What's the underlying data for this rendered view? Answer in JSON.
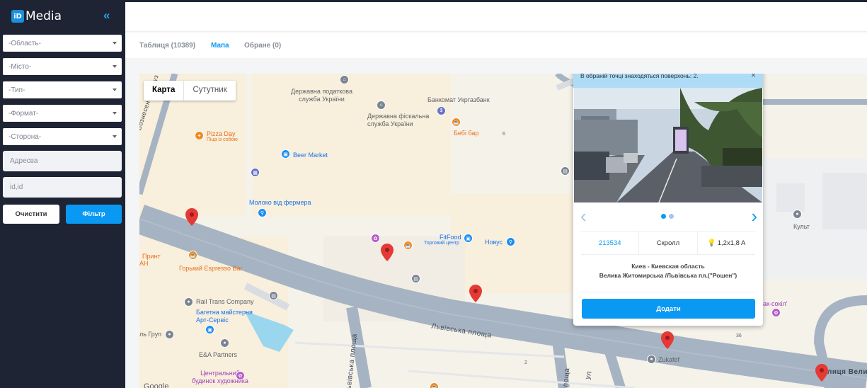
{
  "brand": {
    "logo_mark": "iD",
    "name": "Media"
  },
  "sidebar": {
    "collapse_icon": "«",
    "selects": [
      {
        "placeholder": "-Область-"
      },
      {
        "placeholder": "-Місто-"
      },
      {
        "placeholder": "-Тип-"
      },
      {
        "placeholder": "-Формат-"
      },
      {
        "placeholder": "-Сторона-"
      }
    ],
    "address_placeholder": "Адресва",
    "id_placeholder": "id,id",
    "clear_label": "Очистити",
    "filter_label": "Фільтр"
  },
  "tabs": [
    {
      "label": "Таблиця (10389)",
      "active": false
    },
    {
      "label": "Мапа",
      "active": true
    },
    {
      "label": "Обране (0)",
      "active": false
    }
  ],
  "map": {
    "type_toggle": {
      "map": "Карта",
      "satellite": "Сутутник"
    },
    "pois": {
      "tax_service": "Державна податкова\nслужба України",
      "fiscal_service": "Державна фіскальна\nслужба України",
      "atm": "Банкомат Укргазбанк",
      "bebi_bar": "Бебі бар",
      "pizza_day": "Pizza Day",
      "pizza_day_sub": "Піца із собою",
      "beer_market": "Beer Market",
      "milk": "Молоко від фермера",
      "fitfood": "FitFood",
      "fitfood_sub": "Торговий центр",
      "novus": "Новус",
      "print": "Принт",
      "print_cut": "АН",
      "espresso": "Горький Espresso Bar",
      "rail_trans": "Rail Trans Company",
      "art_service": "Багетна майстерня\nАрт-Сервіс",
      "group": "ль Груп",
      "ea_partners": "E&A Partners",
      "artist_house": "Центральний\nбудинок художника",
      "kult": "Культ",
      "zukafef": "Zukafef",
      "sokil": "ак-сокіл'",
      "google": "Google",
      "num_6": "6",
      "num_2": "2",
      "num_36": "36"
    },
    "streets": {
      "voznesenskyi": "Вознесенський уз",
      "lvivska_pl": "Львівська площа",
      "lvivska_pl_v": "Львівська площа",
      "ploshcha_v": "площа",
      "vulytsia": "лиця Вели",
      "lvivska_ul": "ул"
    }
  },
  "popup": {
    "note": "В обраній точці знаходяться поверхонь: 2.",
    "close_icon": "×",
    "code": "213534",
    "type": "Скролл",
    "size": "1,2x1,8 A",
    "city": "Киев - Киевская область",
    "address": "Велика Житомирська /Львівська пл.(\"Рошен\")",
    "add_label": "Додати",
    "prev_icon": "‹",
    "next_icon": "›"
  },
  "colors": {
    "sidebar": "#1e2433",
    "accent": "#0a99f2",
    "marker": "#e53935",
    "road": "#a6b3c2"
  }
}
